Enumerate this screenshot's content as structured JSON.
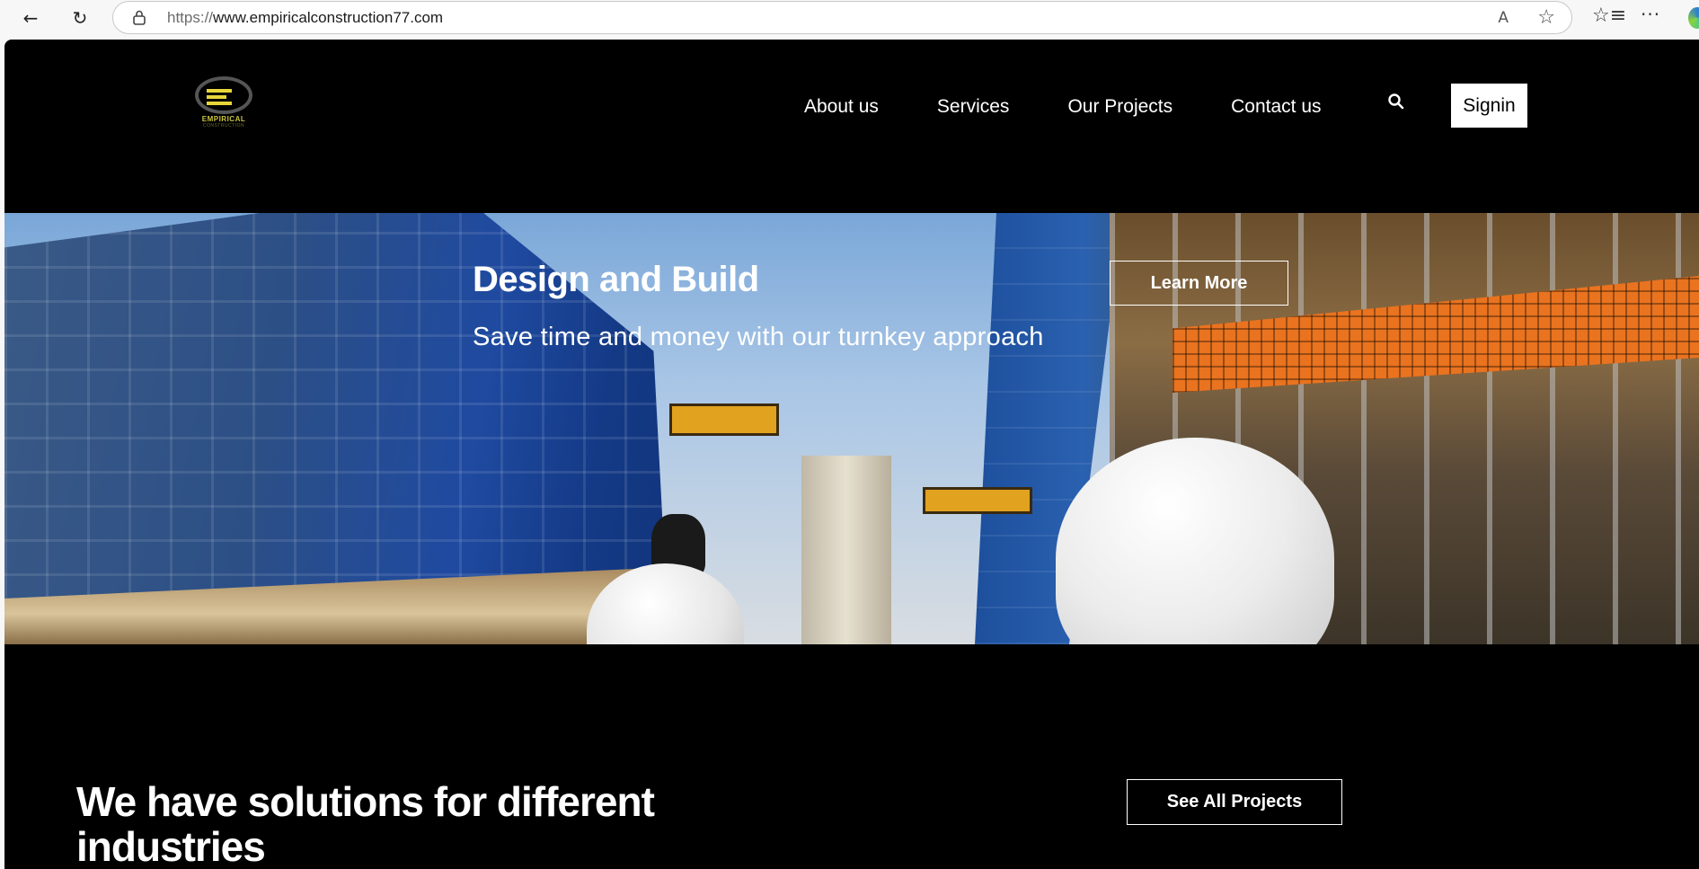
{
  "browser": {
    "url_protocol": "https://",
    "url_host": "www.empiricalconstruction77.com",
    "back_icon": "←",
    "reload_icon": "↻",
    "read_aloud_icon": "A",
    "favorite_icon": "☆",
    "favorites_icon": "☆≡",
    "more_icon": "···"
  },
  "logo": {
    "name": "EMPIRICAL",
    "tagline": "CONSTRUCTION"
  },
  "nav": {
    "items": [
      "About us",
      "Services",
      "Our Projects",
      "Contact us"
    ],
    "signin_label": "Signin"
  },
  "hero": {
    "title": "Design and Build",
    "subtitle": "Save time and money with our turnkey approach",
    "cta_label": "Learn More"
  },
  "section": {
    "heading": "We have solutions for different industries",
    "cta_label": "See All Projects"
  },
  "colors": {
    "page_bg": "#000000",
    "button_bg": "#ffffff",
    "logo_accent": "#e7d53a"
  }
}
